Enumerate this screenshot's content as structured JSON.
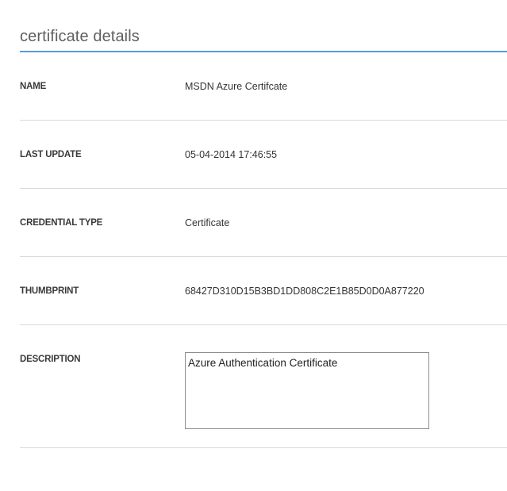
{
  "panel": {
    "title": "certificate details",
    "accent_color": "#5b9bd5"
  },
  "fields": {
    "name": {
      "label": "NAME",
      "value": "MSDN Azure Certifcate"
    },
    "last_update": {
      "label": "LAST UPDATE",
      "value": "05-04-2014 17:46:55"
    },
    "credential_type": {
      "label": "CREDENTIAL TYPE",
      "value": "Certificate"
    },
    "thumbprint": {
      "label": "THUMBPRINT",
      "value": "68427D310D15B3BD1DD808C2E1B85D0D0A877220"
    },
    "description": {
      "label": "DESCRIPTION",
      "value": "Azure Authentication Certificate"
    }
  }
}
